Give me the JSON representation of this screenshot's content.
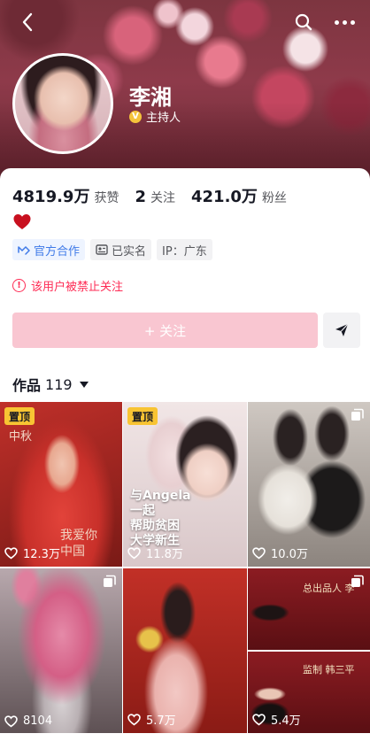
{
  "profile": {
    "name": "李湘",
    "verify_label": "主持人",
    "verify_badge": "V"
  },
  "stats": [
    {
      "num": "4819.9万",
      "label": "获赞"
    },
    {
      "num": "2",
      "label": "关注"
    },
    {
      "num": "421.0万",
      "label": "粉丝"
    }
  ],
  "tags": {
    "official": "官方合作",
    "realname": "已实名",
    "ip": "IP：广东"
  },
  "notice": "该用户被禁止关注",
  "follow_label": "+ 关注",
  "works": {
    "label": "作品",
    "count": "119"
  },
  "videos": [
    {
      "pinned": "置顶",
      "likes": "12.3万",
      "overlay": "我爱你 中国",
      "corner": "中秋",
      "colors": [
        "#c0302a",
        "#7a1a16"
      ]
    },
    {
      "pinned": "置顶",
      "likes": "11.8万",
      "overlay_lines": [
        "与Angela",
        "一起",
        "帮助贫困",
        "大学新生"
      ],
      "colors": [
        "#f1e6e6",
        "#d9c7c9"
      ]
    },
    {
      "likes": "10.0万",
      "colors": [
        "#cfc8c2",
        "#8c847e"
      ]
    },
    {
      "likes": "8104",
      "colors": [
        "#b8a8ad",
        "#5e5154"
      ]
    },
    {
      "likes": "5.7万",
      "colors": [
        "#c23027",
        "#8a1b15"
      ]
    },
    {
      "likes": "5.4万",
      "cards": [
        {
          "text": "总出品人 李",
          "colors": [
            "#8c1c22",
            "#5a0f13"
          ]
        },
        {
          "text": "监制 韩三平",
          "colors": [
            "#8c1c22",
            "#5a0f13"
          ]
        }
      ]
    }
  ],
  "colors": {
    "accent": "#fe2c55",
    "follow_bg": "#f9c6d1",
    "pin_bg": "#f8c433",
    "official_blue": "#3f7ae8"
  }
}
